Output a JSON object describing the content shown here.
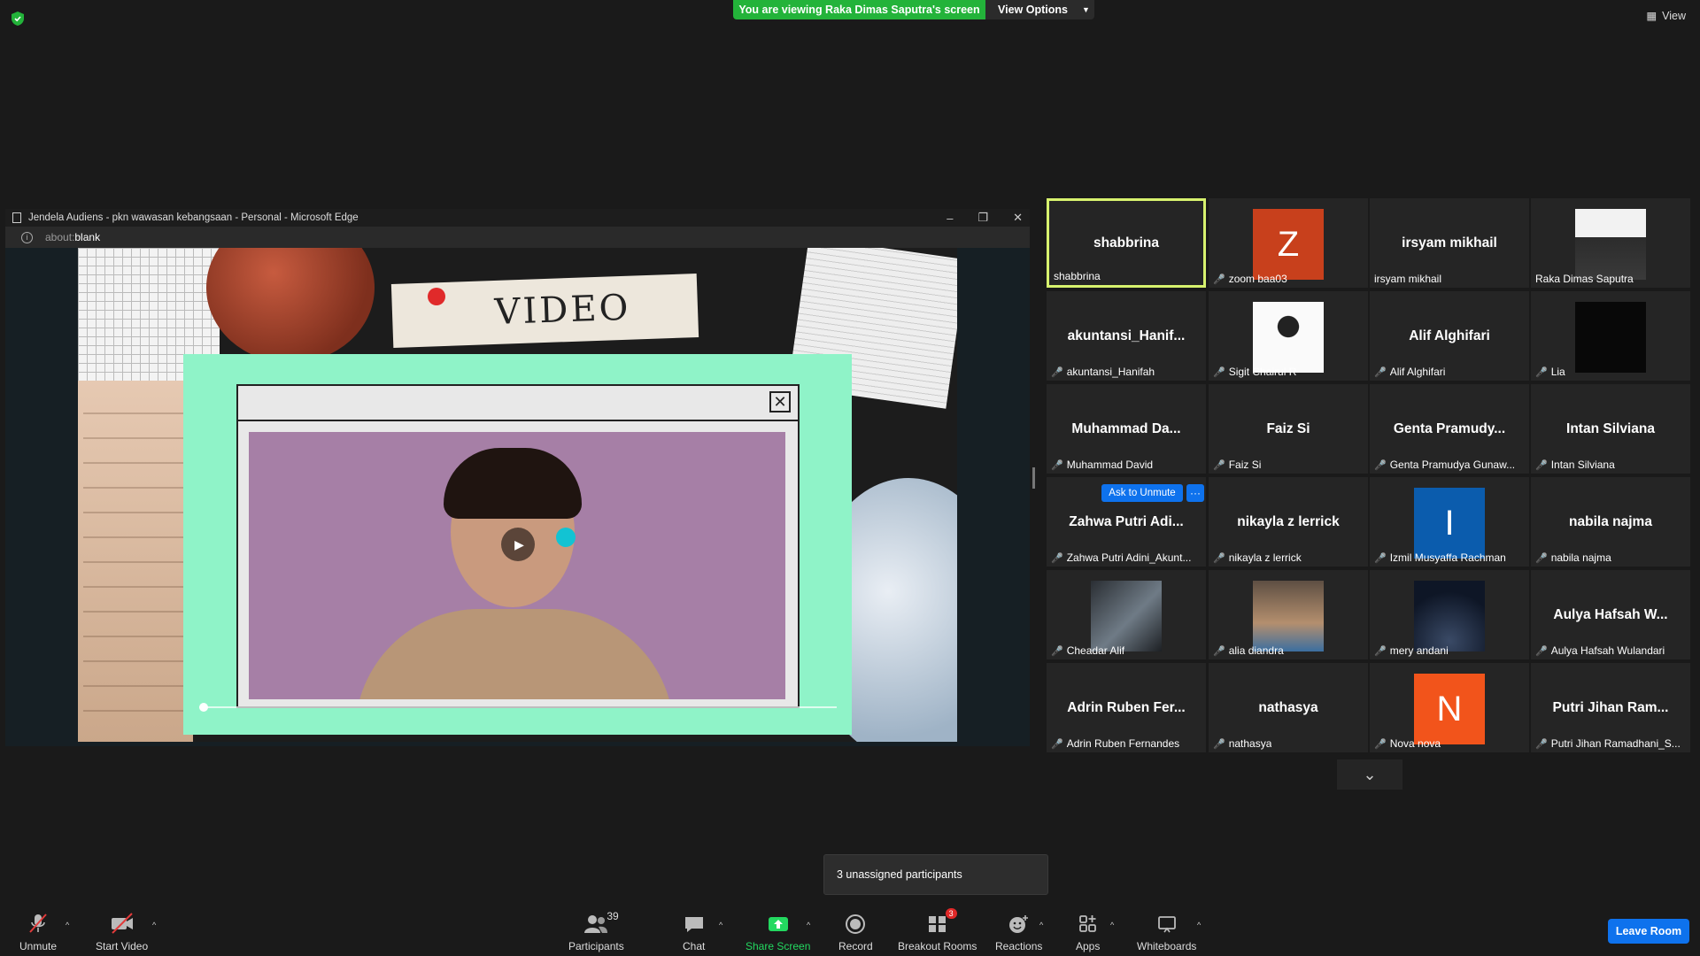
{
  "topbar": {
    "share_banner": "You are viewing Raka Dimas Saputra's screen",
    "view_options": "View Options",
    "view": "View"
  },
  "shared_window": {
    "title": "Jendela Audiens - pkn wawasan kebangsaan - Personal - Microsoft Edge",
    "address_prefix": "about:",
    "address_suffix": "blank",
    "slide_title": "VIDEO"
  },
  "gallery": {
    "tiles": [
      {
        "name": "shabbrina",
        "display": "shabbrina",
        "muted": false,
        "avatar": "name",
        "active": true
      },
      {
        "name": "zoom baa03",
        "display": "Z",
        "muted": true,
        "avatar": "letter",
        "color": "#c8401c"
      },
      {
        "name": "irsyam mikhail",
        "display": "irsyam mikhail",
        "muted": false,
        "avatar": "name"
      },
      {
        "name": "Raka Dimas Saputra",
        "display": "",
        "muted": false,
        "avatar": "photo-portrait"
      },
      {
        "name": "akuntansi_Hanifah",
        "display": "akuntansi_Hanif...",
        "muted": true,
        "avatar": "name"
      },
      {
        "name": "Sigit Chairul R",
        "display": "",
        "muted": true,
        "avatar": "photo-samurai"
      },
      {
        "name": "Alif Alghifari",
        "display": "Alif Alghifari",
        "muted": true,
        "avatar": "name"
      },
      {
        "name": "Lia",
        "display": "",
        "muted": true,
        "avatar": "photo-black"
      },
      {
        "name": "Muhammad David",
        "display": "Muhammad Da...",
        "muted": true,
        "avatar": "name"
      },
      {
        "name": "Faiz Si",
        "display": "Faiz Si",
        "muted": true,
        "avatar": "name"
      },
      {
        "name": "Genta Pramudya Gunaw...",
        "display": "Genta Pramudy...",
        "muted": true,
        "avatar": "name"
      },
      {
        "name": "Intan Silviana",
        "display": "Intan Silviana",
        "muted": true,
        "avatar": "name"
      },
      {
        "name": "Zahwa Putri Adini_Akunt...",
        "display": "Zahwa Putri Adi...",
        "muted": true,
        "avatar": "name"
      },
      {
        "name": "nikayla z lerrick",
        "display": "nikayla z lerrick",
        "muted": true,
        "avatar": "name"
      },
      {
        "name": "Izmil Musyaffa Rachman",
        "display": "I",
        "muted": true,
        "avatar": "letter",
        "color": "#0b5cad"
      },
      {
        "name": "nabila najma",
        "display": "nabila najma",
        "muted": true,
        "avatar": "name"
      },
      {
        "name": "Cheadar Alif",
        "display": "",
        "muted": true,
        "avatar": "photo-car"
      },
      {
        "name": "alia diandra",
        "display": "",
        "muted": true,
        "avatar": "photo-figure"
      },
      {
        "name": "mery andani",
        "display": "",
        "muted": true,
        "avatar": "photo-night"
      },
      {
        "name": "Aulya Hafsah Wulandari",
        "display": "Aulya Hafsah W...",
        "muted": true,
        "avatar": "name"
      },
      {
        "name": "Adrin Ruben Fernandes",
        "display": "Adrin Ruben Fer...",
        "muted": true,
        "avatar": "name"
      },
      {
        "name": "nathasya",
        "display": "nathasya",
        "muted": true,
        "avatar": "name"
      },
      {
        "name": "Nova nova",
        "display": "N",
        "muted": true,
        "avatar": "letter",
        "color": "#f2541b"
      },
      {
        "name": "Putri Jihan Ramadhani_S...",
        "display": "Putri Jihan Ram...",
        "muted": true,
        "avatar": "name"
      }
    ],
    "ask_unmute": "Ask to Unmute",
    "more": "···"
  },
  "tooltip": "3 unassigned participants",
  "toolbar": {
    "unmute": "Unmute",
    "start_video": "Start Video",
    "participants": "Participants",
    "participants_count": "39",
    "chat": "Chat",
    "share_screen": "Share Screen",
    "record": "Record",
    "breakout_rooms": "Breakout Rooms",
    "breakout_badge": "3",
    "reactions": "Reactions",
    "apps": "Apps",
    "whiteboards": "Whiteboards",
    "leave": "Leave Room"
  },
  "colors": {
    "share_green": "#23b33a",
    "active_speaker": "#d7f26e",
    "zoom_blue": "#0e72ed",
    "muted_red": "#e23b3b"
  }
}
